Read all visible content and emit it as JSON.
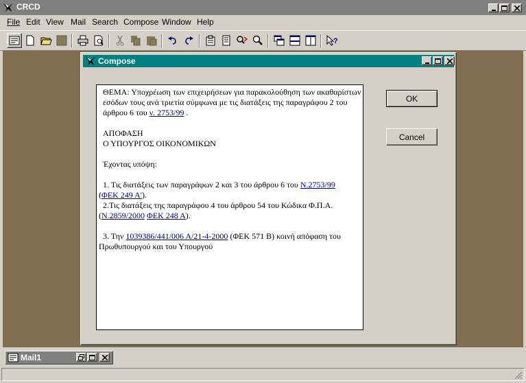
{
  "app": {
    "title": "CRCD"
  },
  "menu": [
    "File",
    "Edit",
    "View",
    "Mail",
    "Search",
    "Compose",
    "Window",
    "Help"
  ],
  "toolbar": {
    "icons": [
      "text-icon",
      "new-document-icon",
      "open-folder-icon",
      "save-icon",
      "print-icon",
      "print-preview-icon",
      "cut-icon",
      "copy-icon",
      "paste-icon",
      "undo-icon",
      "redo-icon",
      "properties-icon",
      "notes-icon",
      "find-replace-icon",
      "search-icon",
      "cascade-icon",
      "tile-horizontal-icon",
      "tile-vertical-icon",
      "context-help-icon"
    ]
  },
  "compose": {
    "title": "Compose",
    "ok_label": "OK",
    "cancel_label": "Cancel",
    "doc": {
      "subject_a": "ΘΕΜΑ: Υποχρέωση των επιχειρήσεων για παρακολούθηση των ακαθαρίστων εσόδων τους ανά τριετία σύμφωνα με τις διατάξεις της παραγράφου 2 του άρθρου 6 του ",
      "subject_link": "ν. 2753/99",
      "subject_b": " .",
      "decision": "ΑΠΟΦΑΣΗ",
      "minister": "Ο ΥΠΟΥΡΓΟΣ ΟΙΚΟΝΟΜΙΚΩΝ",
      "having": "Έχοντας υπόψη:",
      "item1_a": "1. Τις διατάξεις των παραγράφων 2 και 3 του άρθρου 6 του ",
      "item1_link": "Ν.2753/99",
      "item1_b": "(",
      "item1_link2": "ΦΕΚ 249 Α'",
      "item1_c": ").",
      "item2_a": "2.Τις διατάξεις της παραγράφου 4 του άρθρου 54 του Κώδικα Φ.Π.Α. (",
      "item2_link": "Ν.2859/2000",
      "item2_mid": " ",
      "item2_link2": "ΦΕΚ 248 Α",
      "item2_c": ").",
      "item3_a": "3. Την ",
      "item3_link": "1039386/441/006 Α/21-4-2000",
      "item3_b": " (ΦΕΚ 571 Β) κοινή απόφαση του Πρωθυπουργού και του Υπουργού"
    }
  },
  "mail1": {
    "title": "Mail1"
  },
  "colors": {
    "mdi_background": "#7f6e50",
    "active_titlebar": "#008080",
    "inactive_titlebar": "#808080",
    "link": "#000080"
  }
}
